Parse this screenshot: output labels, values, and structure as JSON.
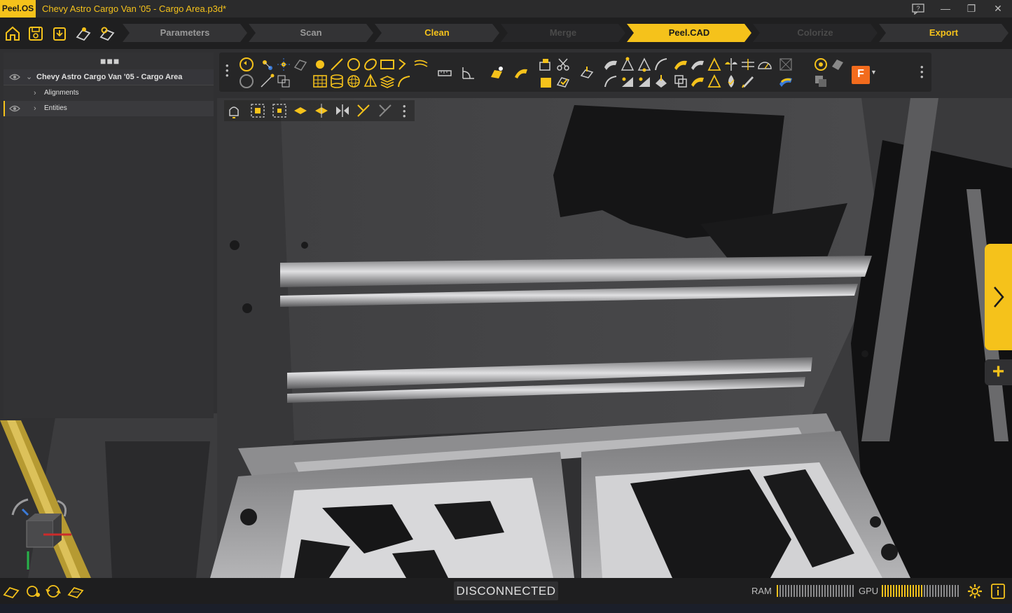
{
  "app": {
    "logo": "Peel.OS",
    "window_title": "Chevy Astro Cargo Van '05 - Cargo Area.p3d*"
  },
  "quick_icons": [
    "home-icon",
    "save-icon",
    "export-file-icon",
    "scanner-icon",
    "scanner-settings-icon"
  ],
  "workflow": {
    "stages": [
      {
        "label": "Parameters",
        "state": "normal"
      },
      {
        "label": "Scan",
        "state": "normal"
      },
      {
        "label": "Clean",
        "state": "bright"
      },
      {
        "label": "Merge",
        "state": "disabled"
      },
      {
        "label": "Peel.CAD",
        "state": "active"
      },
      {
        "label": "Colorize",
        "state": "disabled"
      },
      {
        "label": "Export",
        "state": "bright"
      }
    ]
  },
  "tree": {
    "root": "Chevy Astro Cargo Van '05 - Cargo Area",
    "children": [
      "Alignments",
      "Entities"
    ]
  },
  "status": {
    "connection": "DISCONNECTED",
    "ram_label": "RAM",
    "gpu_label": "GPU",
    "ram_level": 0.05,
    "gpu_level": 0.55
  },
  "colors": {
    "accent": "#f5c21b",
    "background": "#1d1d1e",
    "panel": "#323234",
    "toolbar": "#262627"
  }
}
